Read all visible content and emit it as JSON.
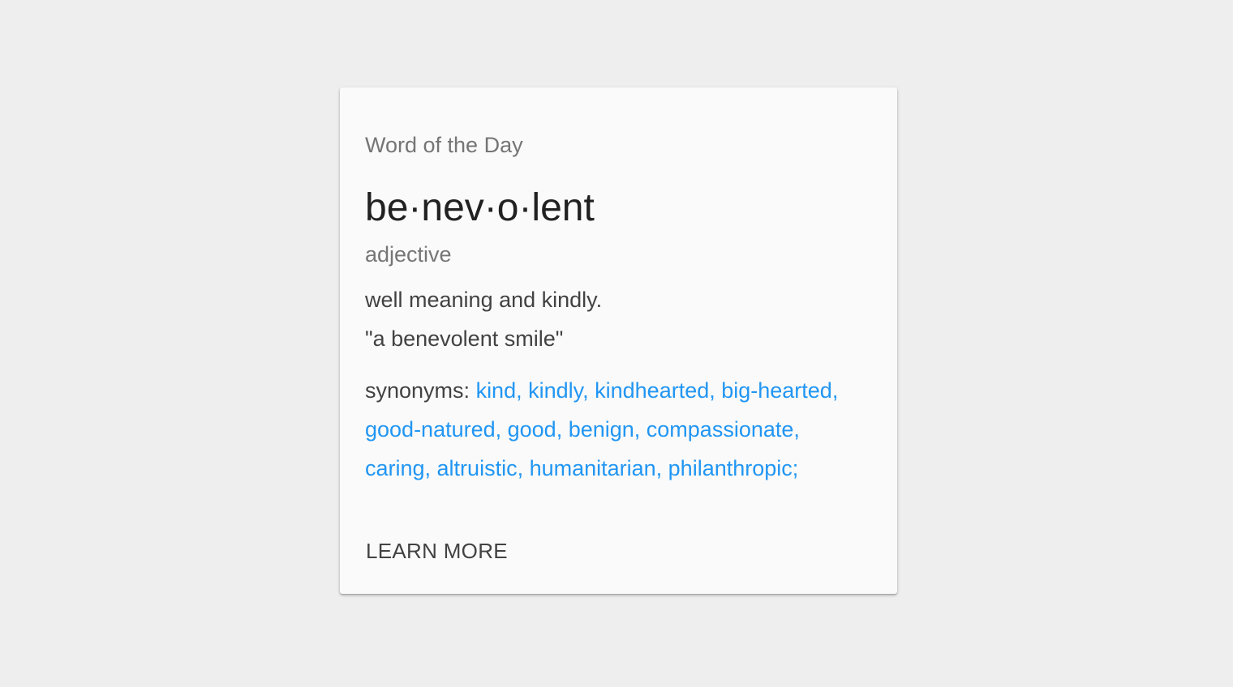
{
  "card": {
    "overline": "Word of the Day",
    "word": "be·nev·o·lent",
    "part_of_speech": "adjective",
    "definition": "well meaning and kindly.",
    "example": "\"a benevolent smile\"",
    "synonyms_label": "synonyms:",
    "synonym_lines": [
      "kind, kindly, kindhearted, big-hearted,",
      "good-natured, good, benign, compassionate,",
      "caring, altruistic, humanitarian, philanthropic;"
    ],
    "action_label": "LEARN MORE"
  },
  "colors": {
    "background": "#eeeeee",
    "card": "#fafafa",
    "primary_text": "#212121",
    "secondary_text": "#757575",
    "body_text": "#424242",
    "link": "#2196f3"
  }
}
